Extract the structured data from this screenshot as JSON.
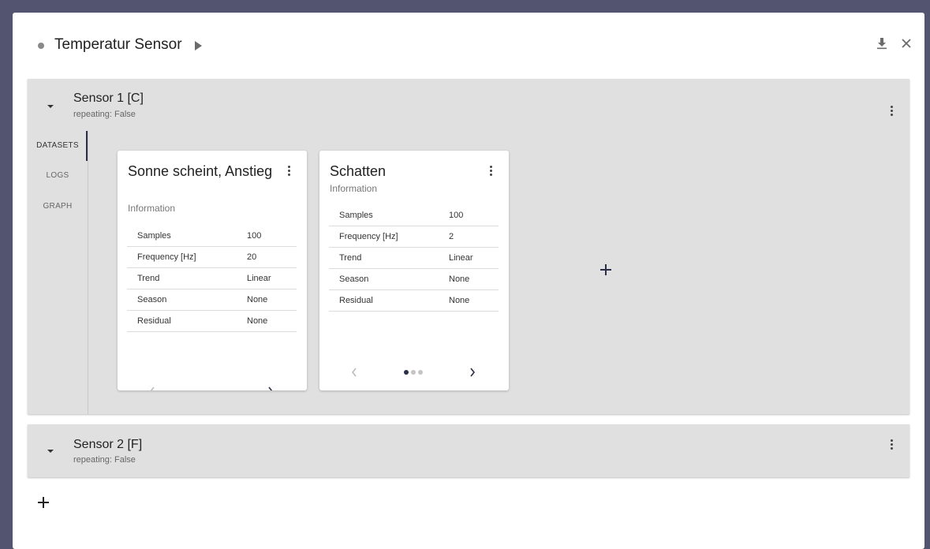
{
  "dialog": {
    "title": "Temperatur Sensor",
    "icons": [
      "status-dot",
      "play-icon",
      "download-icon",
      "close-icon"
    ]
  },
  "sensors": [
    {
      "title": "Sensor 1 [C]",
      "subtitle": "repeating: False",
      "expanded": true,
      "tabs": [
        "DATASETS",
        "LOGS",
        "GRAPH"
      ],
      "active_tab": "DATASETS",
      "datasets": [
        {
          "title": "Sonne scheint, Anstieg",
          "subtitle": "Information",
          "rows": [
            {
              "label": "Samples",
              "value": "100"
            },
            {
              "label": "Frequency [Hz]",
              "value": "20"
            },
            {
              "label": "Trend",
              "value": "Linear"
            },
            {
              "label": "Season",
              "value": "None"
            },
            {
              "label": "Residual",
              "value": "None"
            }
          ]
        },
        {
          "title": "Schatten",
          "subtitle": "Information",
          "rows": [
            {
              "label": "Samples",
              "value": "100"
            },
            {
              "label": "Frequency [Hz]",
              "value": "2"
            },
            {
              "label": "Trend",
              "value": "Linear"
            },
            {
              "label": "Season",
              "value": "None"
            },
            {
              "label": "Residual",
              "value": "None"
            }
          ],
          "pager": {
            "pages": 3,
            "current": 1
          }
        }
      ]
    },
    {
      "title": "Sensor 2 [F]",
      "subtitle": "repeating: False",
      "expanded": false
    }
  ],
  "colors": {
    "backdrop": "#525470",
    "panel": "#e0e0e0",
    "accent": "#2c2e48"
  }
}
